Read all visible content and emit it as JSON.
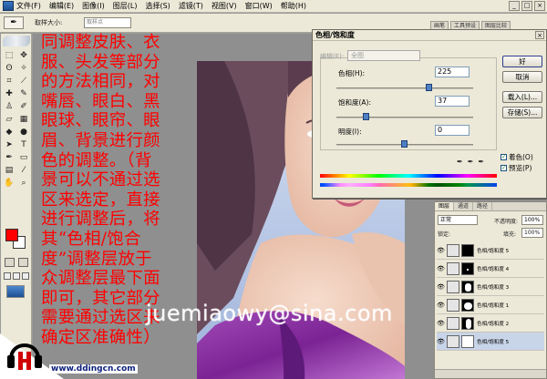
{
  "menu": {
    "items": [
      "文件(F)",
      "编辑(E)",
      "图像(I)",
      "图层(L)",
      "选择(S)",
      "滤镜(T)",
      "视图(V)",
      "窗口(W)",
      "帮助(H)"
    ]
  },
  "window_buttons": [
    "_",
    "□",
    "×"
  ],
  "options_bar": {
    "tool_icon": "eyedropper-icon",
    "sample_label": "取样大小:",
    "sample_value": "取样点",
    "palette_tabs": [
      "画笔",
      "工具预设",
      "图层比较"
    ]
  },
  "toolbox": {
    "foreground_color": "#ff0000",
    "background_color": "#ffffff"
  },
  "overlay_text": "同调整皮肤、衣服、头发等部分的方法相同，对嘴唇、眼白、黑眼球、眼帘、眼眉、背景进行颜色的调整。（背景可以不通过选区来选定，直接进行调整后，将其“色相/饱合度”调整层放于众调整层最下面即可，其它部分需要通过选区来确定区准确性）",
  "watermark": "juemiaowy@sina.com",
  "logo": {
    "url": "www.ddingcn.com"
  },
  "dialog": {
    "title": "色相/饱和度",
    "edit_label": "编辑(E):",
    "edit_value": "全图",
    "hue_label": "色相(H):",
    "hue_value": "225",
    "hue_position": 0.68,
    "saturation_label": "饱和度(A):",
    "saturation_value": "37",
    "saturation_position": 0.22,
    "lightness_label": "明度(I):",
    "lightness_value": "0",
    "lightness_position": 0.5,
    "ok_label": "好",
    "cancel_label": "取消",
    "load_label": "载入(L)...",
    "save_label": "存储(S)...",
    "colorize_label": "着色(O)",
    "colorize_checked": true,
    "preview_label": "预览(P)",
    "preview_checked": true,
    "close_label": "×"
  },
  "layers_panel": {
    "tabs": [
      "图层",
      "通道",
      "路径"
    ],
    "blend_mode": "正常",
    "opacity_label": "不透明度:",
    "opacity_value": "100%",
    "lock_label": "锁定:",
    "fill_label": "填充:",
    "fill_value": "100%",
    "layers": [
      {
        "name": "色相/饱和度 5",
        "mask": "black"
      },
      {
        "name": "色相/饱和度 4",
        "mask": "black-dot"
      },
      {
        "name": "色相/饱和度 3",
        "mask": "black-shape"
      },
      {
        "name": "色相/饱和度 1",
        "mask": "black-shape2"
      },
      {
        "name": "色相/饱和度 2",
        "mask": "black-shape3"
      },
      {
        "name": "色相/饱和度 5",
        "mask": "white-shape"
      }
    ]
  }
}
